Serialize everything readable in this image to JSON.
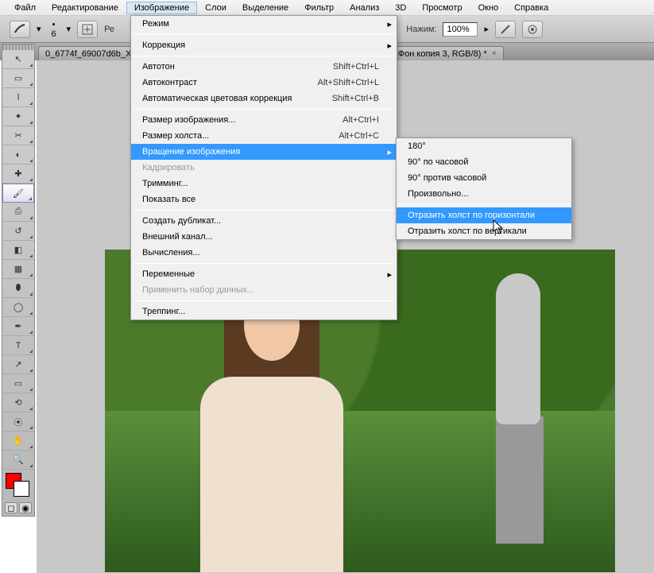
{
  "menubar": {
    "items": [
      "Файл",
      "Редактирование",
      "Изображение",
      "Слои",
      "Выделение",
      "Фильтр",
      "Анализ",
      "3D",
      "Просмотр",
      "Окно",
      "Справка"
    ],
    "active_index": 2
  },
  "optionsbar": {
    "brush_size": "6",
    "mode_prefix": "Ре",
    "opacity_label": "Нажим:",
    "opacity_value": "100%"
  },
  "tabs": [
    {
      "label": "0_6774f_69007d6b_X"
    },
    {
      "label": "(Фон копия 3, RGB/8) *"
    }
  ],
  "tools": [
    {
      "name": "move-tool",
      "glyph": "↖"
    },
    {
      "name": "marquee-tool",
      "glyph": "▭"
    },
    {
      "name": "lasso-tool",
      "glyph": "⌇"
    },
    {
      "name": "wand-tool",
      "glyph": "✦"
    },
    {
      "name": "crop-tool",
      "glyph": "✂"
    },
    {
      "name": "eyedropper-tool",
      "glyph": "◐"
    },
    {
      "name": "healing-tool",
      "glyph": "✚"
    },
    {
      "name": "brush-tool",
      "glyph": "🖌",
      "active": true
    },
    {
      "name": "stamp-tool",
      "glyph": "⎙"
    },
    {
      "name": "history-brush-tool",
      "glyph": "↺"
    },
    {
      "name": "eraser-tool",
      "glyph": "◧"
    },
    {
      "name": "gradient-tool",
      "glyph": "▦"
    },
    {
      "name": "blur-tool",
      "glyph": "⬮"
    },
    {
      "name": "dodge-tool",
      "glyph": "◯"
    },
    {
      "name": "pen-tool",
      "glyph": "✒"
    },
    {
      "name": "type-tool",
      "glyph": "T"
    },
    {
      "name": "path-tool",
      "glyph": "↗"
    },
    {
      "name": "shape-tool",
      "glyph": "▭"
    },
    {
      "name": "3d-tool",
      "glyph": "⟲"
    },
    {
      "name": "3d-camera-tool",
      "glyph": "⦿"
    },
    {
      "name": "hand-tool",
      "glyph": "✋"
    },
    {
      "name": "zoom-tool",
      "glyph": "🔍"
    }
  ],
  "colors": {
    "fg": "#ff0000",
    "bg": "#ffffff"
  },
  "dropdown": {
    "groups": [
      [
        {
          "label": "Режим",
          "arrow": true
        }
      ],
      [
        {
          "label": "Коррекция",
          "arrow": true
        }
      ],
      [
        {
          "label": "Автотон",
          "shortcut": "Shift+Ctrl+L"
        },
        {
          "label": "Автоконтраст",
          "shortcut": "Alt+Shift+Ctrl+L"
        },
        {
          "label": "Автоматическая цветовая коррекция",
          "shortcut": "Shift+Ctrl+B"
        }
      ],
      [
        {
          "label": "Размер изображения...",
          "shortcut": "Alt+Ctrl+I"
        },
        {
          "label": "Размер холста...",
          "shortcut": "Alt+Ctrl+C"
        },
        {
          "label": "Вращение изображения",
          "arrow": true,
          "highlight": true
        },
        {
          "label": "Кадрировать",
          "disabled": true
        },
        {
          "label": "Тримминг..."
        },
        {
          "label": "Показать все"
        }
      ],
      [
        {
          "label": "Создать дубликат..."
        },
        {
          "label": "Внешний канал..."
        },
        {
          "label": "Вычисления..."
        }
      ],
      [
        {
          "label": "Переменные",
          "arrow": true
        },
        {
          "label": "Применить набор данных...",
          "disabled": true
        }
      ],
      [
        {
          "label": "Треппинг..."
        }
      ]
    ]
  },
  "submenu": {
    "groups": [
      [
        {
          "label": "180°"
        },
        {
          "label": "90° по часовой"
        },
        {
          "label": "90° против часовой"
        },
        {
          "label": "Произвольно..."
        }
      ],
      [
        {
          "label": "Отразить холст по горизонтали",
          "highlight": true
        },
        {
          "label": "Отразить холст по вертикали"
        }
      ]
    ]
  }
}
